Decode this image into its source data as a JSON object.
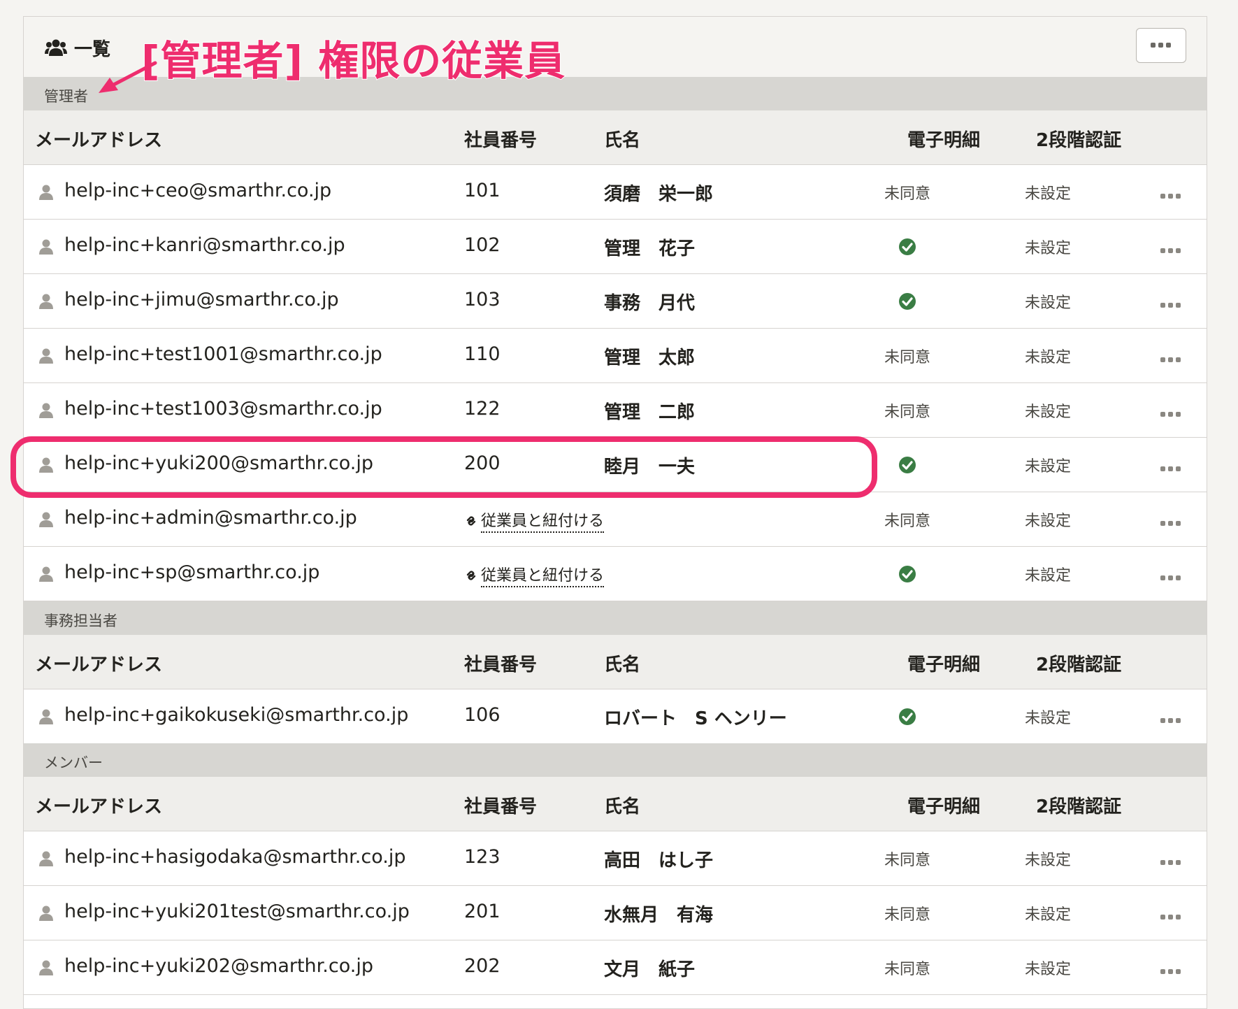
{
  "panel": {
    "title": "一覧"
  },
  "annotation": {
    "text": "[管理者] 権限の従業員"
  },
  "columns": {
    "email": "メールアドレス",
    "employee_no": "社員番号",
    "name": "氏名",
    "esign": "電子明細",
    "twofa": "2段階認証"
  },
  "sections": [
    {
      "title": "管理者",
      "rows": [
        {
          "email": "help-inc+ceo@smarthr.co.jp",
          "employee_no": "101",
          "name": "須磨　栄一郎",
          "esign": "未同意",
          "twofa": "未設定"
        },
        {
          "email": "help-inc+kanri@smarthr.co.jp",
          "employee_no": "102",
          "name": "管理　花子",
          "esign": "",
          "twofa": "未設定"
        },
        {
          "email": "help-inc+jimu@smarthr.co.jp",
          "employee_no": "103",
          "name": "事務　月代",
          "esign": "",
          "twofa": "未設定"
        },
        {
          "email": "help-inc+test1001@smarthr.co.jp",
          "employee_no": "110",
          "name": "管理　太郎",
          "esign": "未同意",
          "twofa": "未設定"
        },
        {
          "email": "help-inc+test1003@smarthr.co.jp",
          "employee_no": "122",
          "name": "管理　二郎",
          "esign": "未同意",
          "twofa": "未設定"
        },
        {
          "email": "help-inc+yuki200@smarthr.co.jp",
          "employee_no": "200",
          "name": "睦月　一夫",
          "esign": "",
          "twofa": "未設定"
        },
        {
          "email": "help-inc+admin@smarthr.co.jp",
          "employee_no": "",
          "link": "従業員と紐付ける",
          "name": "",
          "esign": "未同意",
          "twofa": "未設定"
        },
        {
          "email": "help-inc+sp@smarthr.co.jp",
          "employee_no": "",
          "link": "従業員と紐付ける",
          "name": "",
          "esign": "",
          "twofa": "未設定"
        }
      ]
    },
    {
      "title": "事務担当者",
      "rows": [
        {
          "email": "help-inc+gaikokuseki@smarthr.co.jp",
          "employee_no": "106",
          "name": "ロバート　S ヘンリー",
          "esign": "",
          "twofa": "未設定"
        }
      ]
    },
    {
      "title": "メンバー",
      "rows": [
        {
          "email": "help-inc+hasigodaka@smarthr.co.jp",
          "employee_no": "123",
          "name": "高田　はし子",
          "esign": "未同意",
          "twofa": "未設定"
        },
        {
          "email": "help-inc+yuki201test@smarthr.co.jp",
          "employee_no": "201",
          "name": "水無月　有海",
          "esign": "未同意",
          "twofa": "未設定"
        },
        {
          "email": "help-inc+yuki202@smarthr.co.jp",
          "employee_no": "202",
          "name": "文月　紙子",
          "esign": "未同意",
          "twofa": "未設定"
        }
      ]
    }
  ],
  "icons": {
    "group": "users-icon",
    "person": "person-icon",
    "check": "check-circle-icon",
    "link": "link-icon",
    "more": "ellipsis-icon"
  },
  "colors": {
    "accent": "#ee2d6e",
    "check": "#3a7d44",
    "section_bg": "#d7d6d2",
    "header_bg": "#efeeeb"
  }
}
